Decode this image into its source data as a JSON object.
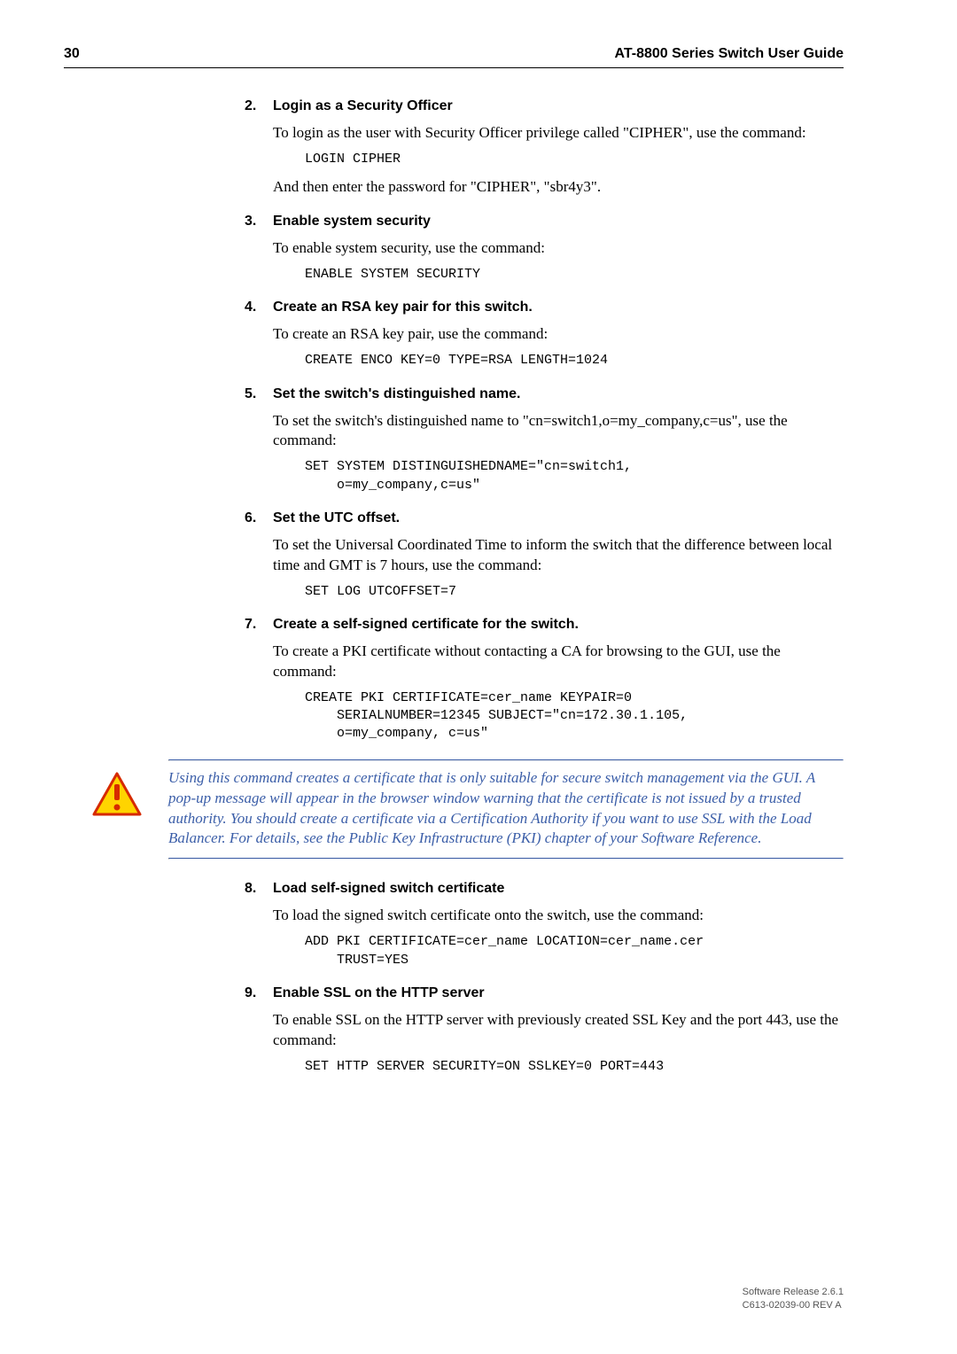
{
  "header": {
    "page_number": "30",
    "doc_title": "AT-8800 Series Switch User Guide"
  },
  "steps": [
    {
      "num": "2.",
      "title": "Login as a Security Officer",
      "body1": "To login as the user with Security Officer privilege called \"CIPHER\", use the command:",
      "code1": "LOGIN CIPHER",
      "body2": "And then enter the password for \"CIPHER\", \"sbr4y3\"."
    },
    {
      "num": "3.",
      "title": "Enable system security",
      "body1": "To enable system security, use the command:",
      "code1": "ENABLE SYSTEM SECURITY"
    },
    {
      "num": "4.",
      "title": "Create an RSA key pair for this switch.",
      "body1": "To create an RSA key pair, use the command:",
      "code1": "CREATE ENCO KEY=0 TYPE=RSA LENGTH=1024"
    },
    {
      "num": "5.",
      "title": "Set the switch's distinguished name.",
      "body1": "To set the switch's distinguished name to \"cn=switch1,o=my_company,c=us\", use the command:",
      "code1": "SET SYSTEM DISTINGUISHEDNAME=\"cn=switch1,\n    o=my_company,c=us\""
    },
    {
      "num": "6.",
      "title": "Set the UTC offset.",
      "body1": "To set the Universal Coordinated Time to inform the switch that the difference between local time and GMT is 7 hours, use the command:",
      "code1": "SET LOG UTCOFFSET=7"
    },
    {
      "num": "7.",
      "title": "Create a self-signed certificate for the switch.",
      "body1": "To create a PKI certificate without contacting a CA for browsing to the GUI, use the command:",
      "code1": "CREATE PKI CERTIFICATE=cer_name KEYPAIR=0\n    SERIALNUMBER=12345 SUBJECT=\"cn=172.30.1.105,\n    o=my_company, c=us\""
    }
  ],
  "warning_text": "Using this command creates a certificate that is only suitable for secure switch management via the GUI. A pop-up message will appear in the browser window warning that the certificate is not issued by a trusted authority. You should create a certificate via a Certification Authority if you want to use SSL with the Load Balancer. For details, see the Public Key Infrastructure (PKI) chapter of your Software Reference.",
  "steps2": [
    {
      "num": "8.",
      "title": "Load self-signed switch certificate",
      "body1": "To load the signed switch certificate onto the switch, use the command:",
      "code1": "ADD PKI CERTIFICATE=cer_name LOCATION=cer_name.cer\n    TRUST=YES"
    },
    {
      "num": "9.",
      "title": "Enable SSL on the HTTP server",
      "body1": "To enable SSL on the HTTP server with previously created SSL Key and the port 443, use the command:",
      "code1": "SET HTTP SERVER SECURITY=ON SSLKEY=0 PORT=443"
    }
  ],
  "footer": {
    "line1": "Software Release 2.6.1",
    "line2": "C613-02039-00 REV A"
  }
}
